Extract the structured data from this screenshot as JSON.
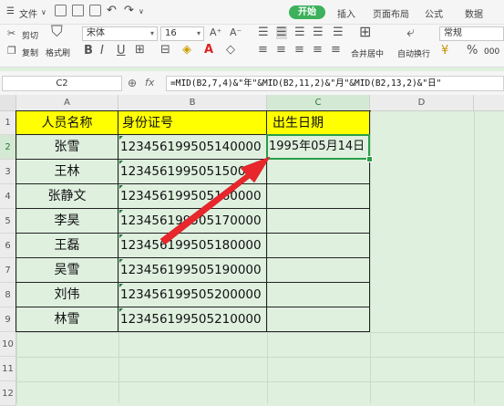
{
  "menu": {
    "file_label": "文件",
    "file_arrow": "∨",
    "tabs": [
      "开始",
      "插入",
      "页面布局",
      "公式",
      "数据"
    ]
  },
  "ribbon": {
    "cut": "剪切",
    "copy": "复制",
    "format_painter": "格式刷",
    "font_name": "宋体",
    "font_size": "16",
    "bold": "B",
    "italic": "I",
    "underline": "U",
    "font_color_glyph": "A",
    "merge_center": "合并居中",
    "wrap_text": "自动换行",
    "number_format": "常规",
    "percent": "%",
    "comma": "000"
  },
  "formula_bar": {
    "name_box": "C2",
    "fx": "fx",
    "zoom_glyph": "⊕",
    "formula": "=MID(B2,7,4)&\"年\"&MID(B2,11,2)&\"月\"&MID(B2,13,2)&\"日\""
  },
  "grid": {
    "columns": [
      "A",
      "B",
      "C",
      "D"
    ],
    "rows": [
      "1",
      "2",
      "3",
      "4",
      "5",
      "6",
      "7",
      "8",
      "9",
      "10",
      "11",
      "12"
    ],
    "header": [
      "人员名称",
      "身份证号",
      "出生日期"
    ],
    "names": [
      "张雪",
      "王林",
      "张静文",
      "李昊",
      "王磊",
      "吴雪",
      "刘伟",
      "林雪"
    ],
    "ids": [
      "123456199505140000",
      "123456199505150000",
      "123456199505160000",
      "123456199505170000",
      "123456199505180000",
      "123456199505190000",
      "123456199505200000",
      "123456199505210000"
    ],
    "c2_value": "1995年05月14日",
    "selected_cell": "C2"
  },
  "colors": {
    "header_fill": "#ffff00",
    "sheet_bg": "#dff0df",
    "selection": "#2a9d47",
    "arrow": "#e8262c",
    "accent": "#3db15b"
  }
}
